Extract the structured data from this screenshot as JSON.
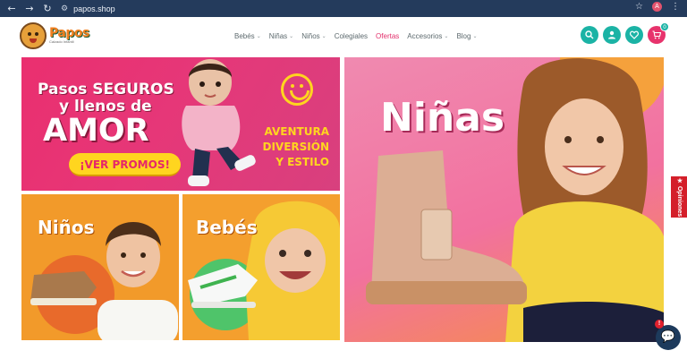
{
  "browser": {
    "url": "papos.shop",
    "profile_initial": "A"
  },
  "header": {
    "brand": "Papos",
    "tagline": "Calzado Infantil",
    "nav": [
      {
        "label": "Bebés",
        "has_dropdown": true
      },
      {
        "label": "Niñas",
        "has_dropdown": true
      },
      {
        "label": "Niños",
        "has_dropdown": true
      },
      {
        "label": "Colegiales",
        "has_dropdown": false
      },
      {
        "label": "Ofertas",
        "has_dropdown": false,
        "highlight": "#e2306c"
      },
      {
        "label": "Accesorios",
        "has_dropdown": true
      },
      {
        "label": "Blog",
        "has_dropdown": true
      }
    ],
    "icons": [
      "search-icon",
      "user-icon",
      "heart-icon",
      "cart-icon"
    ],
    "cart_count": "0",
    "accent": "#1bb3a5",
    "cart_color": "#e7336c"
  },
  "promo": {
    "line1": "Pasos SEGUROS",
    "line2": "y llenos de",
    "line3": "AMOR",
    "cta": "¡VER PROMOS!",
    "side_line1": "AVENTURA",
    "side_line2": "DIVERSIÓN",
    "side_line3": "Y ESTILO"
  },
  "categories": {
    "ninos": "Niños",
    "bebes": "Bebés",
    "ninas": "Niñas"
  },
  "widgets": {
    "feedback_tab": "★ Opiniones",
    "chat_badge": "!"
  }
}
